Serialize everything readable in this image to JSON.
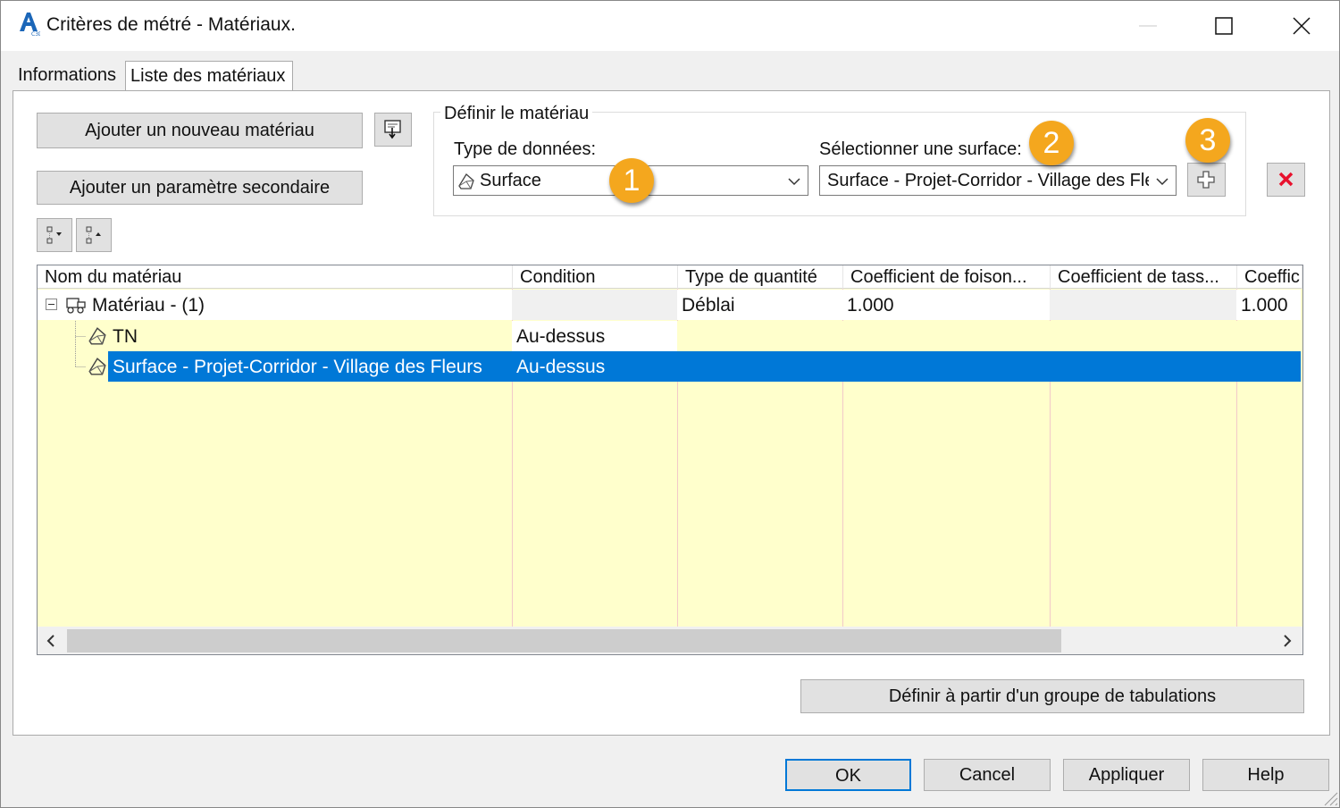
{
  "window": {
    "title": "Critères de métré - Matériaux.",
    "controls": [
      "minimize-icon",
      "maximize-icon",
      "close-icon"
    ]
  },
  "tabs": [
    {
      "label": "Informations",
      "active": false
    },
    {
      "label": "Liste des matériaux",
      "active": true
    }
  ],
  "toolbar": {
    "add_material_label": "Ajouter un nouveau matériau",
    "add_param_label": "Ajouter un paramètre secondaire",
    "import_icon": "import-icon",
    "expand_icon": "expand-all-icon",
    "collapse_icon": "collapse-all-icon"
  },
  "define_material": {
    "legend": "Définir le matériau",
    "data_type_label": "Type de données:",
    "data_type_value": "Surface",
    "select_surface_label": "Sélectionner une surface:",
    "select_surface_value": "Surface - Projet-Corridor - Village des Fleurs",
    "add_icon": "add-icon",
    "delete_icon": "delete-icon"
  },
  "callouts": [
    "1",
    "2",
    "3"
  ],
  "grid": {
    "columns": [
      "Nom du matériau",
      "Condition",
      "Type de quantité",
      "Coefficient de foison...",
      "Coefficient de tass...",
      "Coeffic"
    ],
    "rows": [
      {
        "name": "Matériau - (1)",
        "condition": "",
        "quantity_type": "Déblai",
        "swell": "1.000",
        "shrink": "",
        "other": "1.000"
      },
      {
        "name": "TN",
        "condition": "Au-dessus",
        "quantity_type": "",
        "swell": "",
        "shrink": "",
        "other": ""
      },
      {
        "name": "Surface - Projet-Corridor - Village des Fleurs",
        "condition": "Au-dessus",
        "quantity_type": "",
        "swell": "",
        "shrink": "",
        "other": ""
      }
    ]
  },
  "define_group_label": "Définir à partir d'un groupe de tabulations",
  "footer": {
    "ok": "OK",
    "cancel": "Cancel",
    "apply": "Appliquer",
    "help": "Help"
  },
  "colors": {
    "selection": "#0078d7",
    "grid_background": "#ffffcc",
    "callout": "#f4a71e",
    "delete_red": "#e8112d"
  }
}
